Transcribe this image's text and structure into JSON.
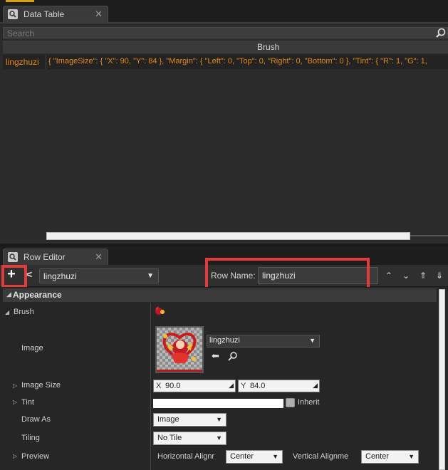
{
  "data_table_tab": {
    "title": "Data Table",
    "close": "✕"
  },
  "search": {
    "placeholder": "Search"
  },
  "table": {
    "column_header": "Brush",
    "rows": [
      {
        "name": "lingzhuzi",
        "value": "{ \"ImageSize\": { \"X\": 90, \"Y\": 84 }, \"Margin\": { \"Left\": 0, \"Top\": 0, \"Right\": 0, \"Bottom\": 0 }, \"Tint\": { \"R\": 1, \"G\": 1,"
      }
    ]
  },
  "row_editor_tab": {
    "title": "Row Editor",
    "close": "✕"
  },
  "toolbar": {
    "add_label": "+",
    "back_label": "<",
    "row_select_value": "lingzhuzi",
    "row_name_label": "Row Name:",
    "row_name_value": "lingzhuzi",
    "nav": [
      "⌃",
      "⌄",
      "⇑",
      "⇓"
    ]
  },
  "properties": {
    "section": "Appearance",
    "brush_label": "Brush",
    "image_label": "Image",
    "image_asset": "lingzhuzi",
    "image_size_label": "Image Size",
    "image_size_x_axis": "X",
    "image_size_x": "90.0",
    "image_size_y_axis": "Y",
    "image_size_y": "84.0",
    "tint_label": "Tint",
    "inherit_label": "Inherit",
    "draw_as_label": "Draw As",
    "draw_as_value": "Image",
    "tiling_label": "Tiling",
    "tiling_value": "No Tile",
    "preview_label": "Preview",
    "horizontal_label": "Horizontal Alignr",
    "horizontal_value": "Center",
    "vertical_label": "Vertical Alignme",
    "vertical_value": "Center"
  },
  "colors": {
    "highlight": "#e23b3b",
    "row_text": "#e58a12",
    "accent_top": "#d8a400"
  }
}
